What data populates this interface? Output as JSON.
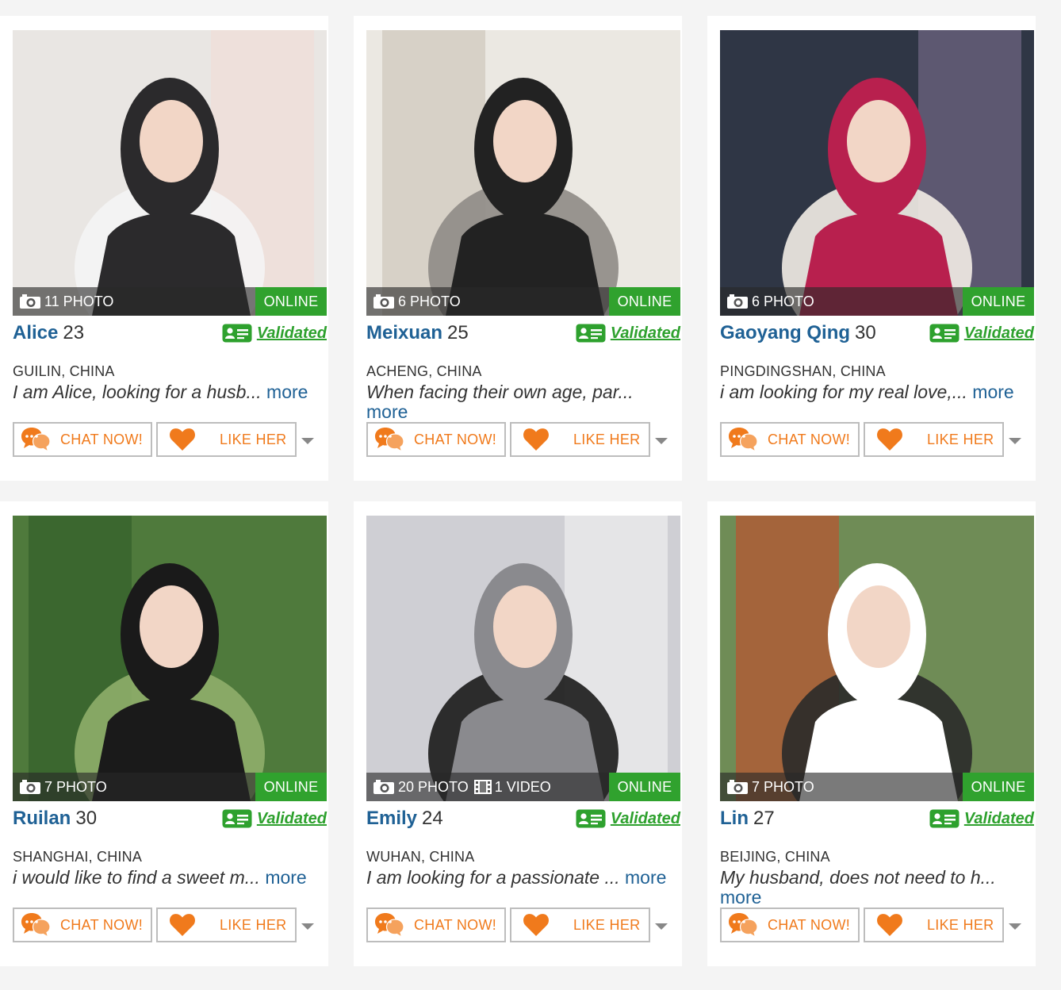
{
  "colors": {
    "name_blue": "#1f6195",
    "online_green": "#30a22e",
    "validated_green": "#2ea12e",
    "button_orange": "#f07a1c",
    "photo_bar": "rgba(40,40,40,0.62)"
  },
  "icons": [
    "camera-icon",
    "video-icon",
    "id-card-icon",
    "chat-bubble-icon",
    "heart-icon",
    "caret-down-icon"
  ],
  "profiles": [
    {
      "name": "Alice",
      "age": "23",
      "location": "GUILIN, CHINA",
      "description": "I am Alice, looking for a husb...",
      "more": "more",
      "photos": "11 PHOTO",
      "videos": "",
      "status": "ONLINE",
      "validated": "Validated",
      "chat_label": "CHAT NOW!",
      "like_label": "LIKE HER"
    },
    {
      "name": "Meixuan",
      "age": "25",
      "location": "ACHENG, CHINA",
      "description": "When facing their own age, par...",
      "more": "more",
      "photos": "6 PHOTO",
      "videos": "",
      "status": "ONLINE",
      "validated": "Validated",
      "chat_label": "CHAT NOW!",
      "like_label": "LIKE HER"
    },
    {
      "name": "Gaoyang Qing",
      "age": "30",
      "location": "PINGDINGSHAN, CHINA",
      "description": "i am looking for my real love,...",
      "more": "more",
      "photos": "6 PHOTO",
      "videos": "",
      "status": "ONLINE",
      "validated": "Validated",
      "chat_label": "CHAT NOW!",
      "like_label": "LIKE HER"
    },
    {
      "name": "Ruilan",
      "age": "30",
      "location": "SHANGHAI, CHINA",
      "description": "i would like to find a sweet m...",
      "more": "more",
      "photos": "7 PHOTO",
      "videos": "",
      "status": "ONLINE",
      "validated": "Validated",
      "chat_label": "CHAT NOW!",
      "like_label": "LIKE HER"
    },
    {
      "name": "Emily",
      "age": "24",
      "location": "WUHAN, CHINA",
      "description": "I am looking for a passionate ...",
      "more": "more",
      "photos": "20 PHOTO",
      "videos": "1 VIDEO",
      "status": "ONLINE",
      "validated": "Validated",
      "chat_label": "CHAT NOW!",
      "like_label": "LIKE HER"
    },
    {
      "name": "Lin",
      "age": "27",
      "location": "BEIJING, CHINA",
      "description": "My husband, does not need to h...",
      "more": "more",
      "photos": "7 PHOTO",
      "videos": "",
      "status": "ONLINE",
      "validated": "Validated",
      "chat_label": "CHAT NOW!",
      "like_label": "LIKE HER"
    }
  ]
}
